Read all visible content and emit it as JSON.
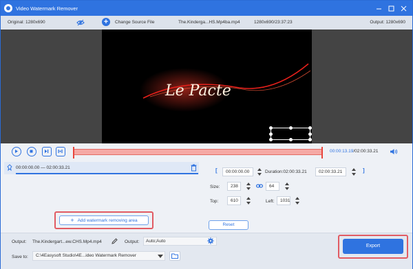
{
  "window": {
    "title": "Video Watermark Remover"
  },
  "infobar": {
    "original": "Original: 1280x690",
    "change_source": "Change Source File",
    "file_name": "The.Kinderga...HS.Mp4ba.mp4",
    "file_dims": "1280x690/23:37:23",
    "output": "Output: 1280x690"
  },
  "video": {
    "title_text": "Le Pacte"
  },
  "controls": {
    "current_time": "00:00:13.19",
    "total_time": "/02:00:33.21"
  },
  "range": {
    "text": "00:00:00.00  —  02:00:33.21"
  },
  "actions": {
    "add_area": "Add watermark removing area",
    "reset": "Reset",
    "export": "Export"
  },
  "params": {
    "start": "00:00:00.00",
    "duration": "Duration:02:00:33.21",
    "end": "02:00:33.21",
    "size_label": "Size:",
    "width": "238",
    "height": "64",
    "top_label": "Top:",
    "top": "610",
    "left_label": "Left:",
    "left": "1031",
    "bracket_open": "[",
    "bracket_close": "]"
  },
  "output": {
    "label": "Output:",
    "file": "The.Kindergart...ew.CHS.Mp4.mp4",
    "format_label": "Output:",
    "format": "Auto;Auto",
    "save_label": "Save to:",
    "save_path": "C:\\4Easysoft Studio\\4E...ideo Watermark Remover"
  },
  "colors": {
    "accent": "#2f73e0",
    "timeline": "#f5a9a5",
    "highlight": "#e15b63"
  }
}
